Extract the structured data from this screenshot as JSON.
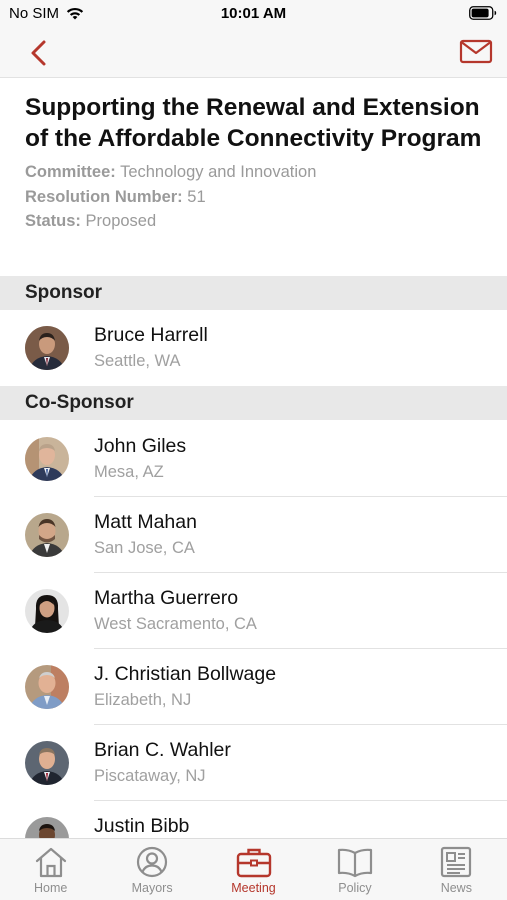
{
  "status_bar": {
    "carrier": "No SIM",
    "time": "10:01 AM"
  },
  "colors": {
    "accent": "#b5372c",
    "inactive": "#8e8e8e",
    "section_bg": "#e8e8e8"
  },
  "nav": {
    "back_icon": "chevron-left-icon",
    "mail_icon": "envelope-icon"
  },
  "resolution": {
    "title": "Supporting the Renewal and Extension of the Affordable Connectivity Program",
    "committee_label": "Committee:",
    "committee_value": "Technology and Innovation",
    "number_label": "Resolution Number:",
    "number_value": "51",
    "status_label": "Status:",
    "status_value": "Proposed"
  },
  "sponsor": {
    "header": "Sponsor",
    "people": [
      {
        "name": "Bruce Harrell",
        "city": "Seattle, WA"
      }
    ]
  },
  "co_sponsor": {
    "header": "Co-Sponsor",
    "people": [
      {
        "name": "John Giles",
        "city": "Mesa, AZ"
      },
      {
        "name": "Matt Mahan",
        "city": "San Jose, CA"
      },
      {
        "name": "Martha Guerrero",
        "city": "West Sacramento, CA"
      },
      {
        "name": "J. Christian Bollwage",
        "city": "Elizabeth, NJ"
      },
      {
        "name": "Brian C. Wahler",
        "city": "Piscataway, NJ"
      },
      {
        "name": "Justin Bibb",
        "city": ""
      }
    ]
  },
  "tabs": [
    {
      "label": "Home",
      "icon": "house-icon"
    },
    {
      "label": "Mayors",
      "icon": "person-icon"
    },
    {
      "label": "Meeting",
      "icon": "briefcase-icon",
      "active": true
    },
    {
      "label": "Policy",
      "icon": "book-icon"
    },
    {
      "label": "News",
      "icon": "newspaper-icon"
    }
  ]
}
